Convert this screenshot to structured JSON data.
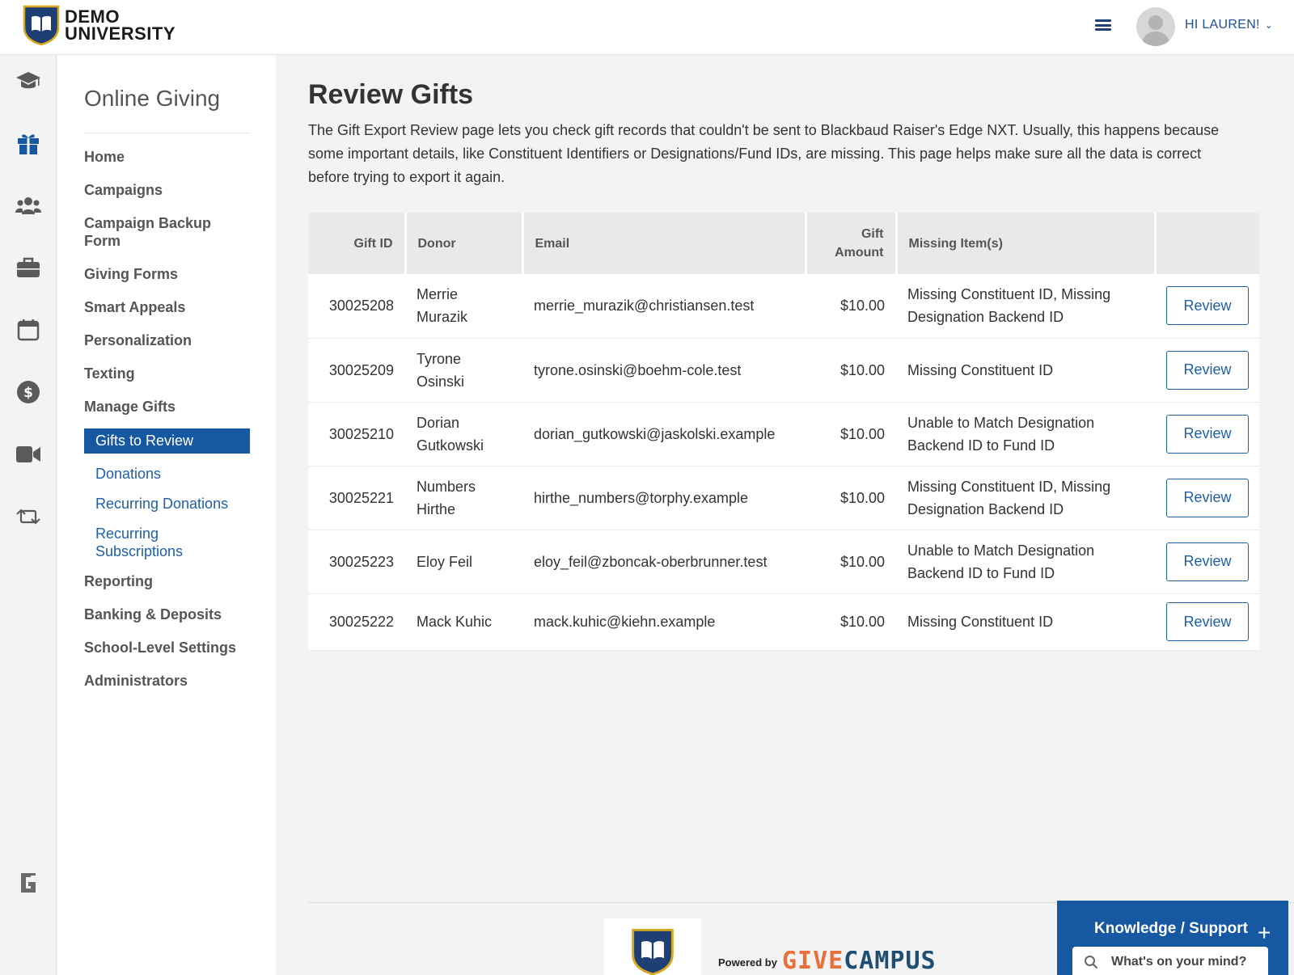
{
  "header": {
    "logo_line1": "DEMO",
    "logo_line2": "UNIVERSITY",
    "greeting": "HI LAUREN!"
  },
  "rail": {
    "icons": [
      "graduation-cap-icon",
      "gift-icon",
      "users-icon",
      "briefcase-icon",
      "calendar-icon",
      "dollar-icon",
      "video-icon",
      "sync-icon",
      "givecampus-g-icon"
    ],
    "active_icon": "gift-icon",
    "accent": "#1758a3"
  },
  "sidebar": {
    "title": "Online Giving",
    "items": [
      {
        "label": "Home"
      },
      {
        "label": "Campaigns"
      },
      {
        "label": "Campaign Backup Form"
      },
      {
        "label": "Giving Forms"
      },
      {
        "label": "Smart Appeals"
      },
      {
        "label": "Personalization"
      },
      {
        "label": "Texting"
      },
      {
        "label": "Manage Gifts"
      }
    ],
    "active_item": "Gifts to Review",
    "sub_items": [
      {
        "label": "Donations"
      },
      {
        "label": "Recurring Donations"
      },
      {
        "label": "Recurring Subscriptions"
      }
    ],
    "items_after": [
      {
        "label": "Reporting"
      },
      {
        "label": "Banking & Deposits"
      },
      {
        "label": "School-Level Settings"
      },
      {
        "label": "Administrators"
      }
    ]
  },
  "main": {
    "title": "Review Gifts",
    "intro": "The Gift Export Review page lets you check gift records that couldn't be sent to Blackbaud Raiser's Edge NXT. Usually, this happens because some important details, like Constituent Identifiers or Designations/Fund IDs, are missing. This page helps make sure all the data is correct before trying to export it again."
  },
  "table": {
    "columns": [
      "Gift ID",
      "Donor",
      "Email",
      "Gift Amount",
      "Missing Item(s)",
      ""
    ],
    "button_label": "Review",
    "rows": [
      {
        "gift_id": "30025208",
        "donor": "Merrie Murazik",
        "email": "merrie_murazik@christiansen.test",
        "amount": "$10.00",
        "missing": "Missing Constituent ID, Missing Designation Backend ID"
      },
      {
        "gift_id": "30025209",
        "donor": "Tyrone Osinski",
        "email": "tyrone.osinski@boehm-cole.test",
        "amount": "$10.00",
        "missing": "Missing Constituent ID"
      },
      {
        "gift_id": "30025210",
        "donor": "Dorian Gutkowski",
        "email": "dorian_gutkowski@jaskolski.example",
        "amount": "$10.00",
        "missing": "Unable to Match Designation Backend ID to Fund ID"
      },
      {
        "gift_id": "30025221",
        "donor": "Numbers Hirthe",
        "email": "hirthe_numbers@torphy.example",
        "amount": "$10.00",
        "missing": "Missing Constituent ID, Missing Designation Backend ID"
      },
      {
        "gift_id": "30025223",
        "donor": "Eloy Feil",
        "email": "eloy_feil@zboncak-oberbrunner.test",
        "amount": "$10.00",
        "missing": "Unable to Match Designation Backend ID to Fund ID"
      },
      {
        "gift_id": "30025222",
        "donor": "Mack Kuhic",
        "email": "mack.kuhic@kiehn.example",
        "amount": "$10.00",
        "missing": "Missing Constituent ID"
      }
    ]
  },
  "footer": {
    "powered_by": "Powered by",
    "brand_part1": "GIVE",
    "brand_part2": "CAMPUS"
  },
  "support": {
    "title": "Knowledge / Support",
    "placeholder": "What's on your mind?"
  }
}
